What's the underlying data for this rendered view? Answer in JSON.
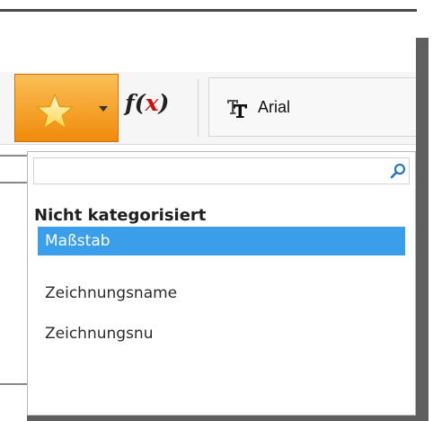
{
  "toolbar": {
    "favorites_button": {
      "icon": "star-icon",
      "accent_color": "#f5a623"
    },
    "formula_button": {
      "label_f": "f(",
      "label_x": "x",
      "label_close": ")"
    },
    "font_selector": {
      "icon": "font-tt-icon",
      "value": "Arial"
    }
  },
  "dropdown": {
    "search": {
      "value": "",
      "placeholder": "",
      "icon": "search-icon"
    },
    "category_title": "Nicht kategorisiert",
    "items": [
      {
        "label": "Maßstab",
        "selected": true
      },
      {
        "label": "Zeichnungsname",
        "selected": false
      },
      {
        "label": "Zeichnungsnu",
        "selected": false
      }
    ],
    "selection_color": "#3b9eea"
  }
}
